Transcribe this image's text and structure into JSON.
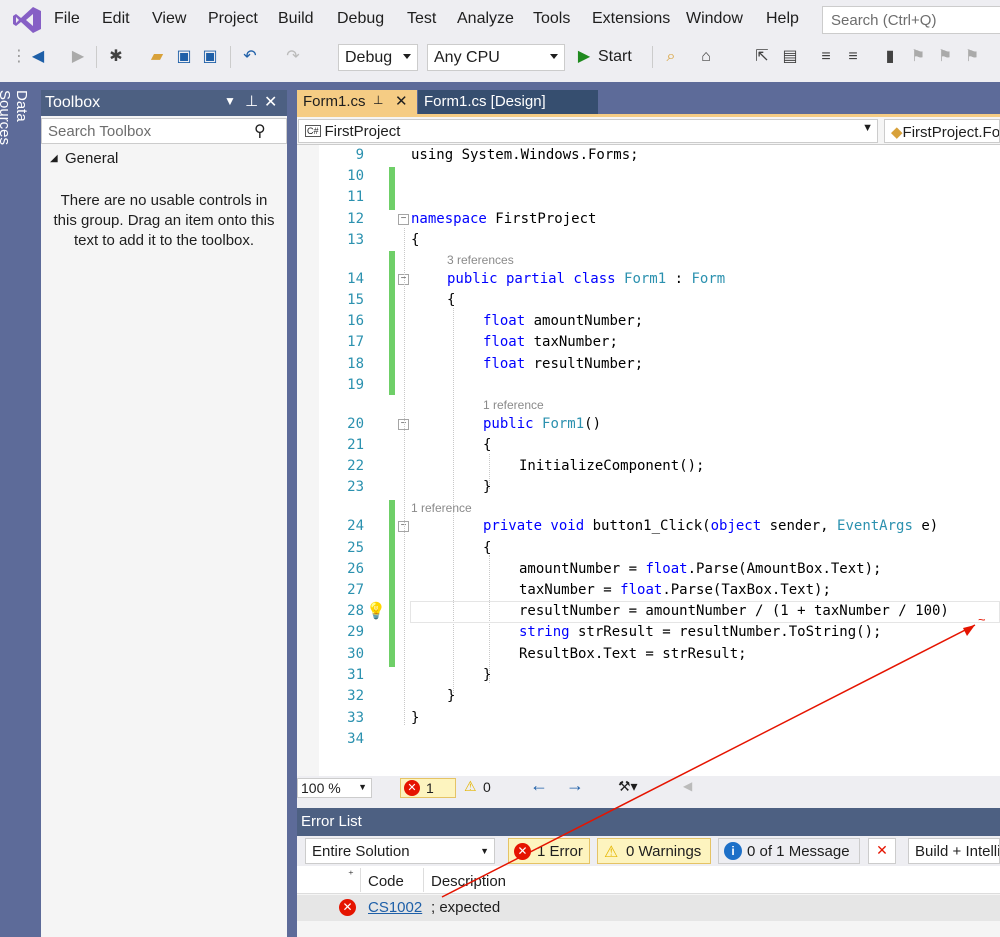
{
  "menu": {
    "items": [
      "File",
      "Edit",
      "View",
      "Project",
      "Build",
      "Debug",
      "Test",
      "Analyze",
      "Tools",
      "Extensions",
      "Window",
      "Help"
    ],
    "search_placeholder": "Search (Ctrl+Q)"
  },
  "toolbar": {
    "config": "Debug",
    "platform": "Any CPU",
    "start_label": "Start"
  },
  "side_tab": {
    "label": "Data Sources"
  },
  "toolbox": {
    "title": "Toolbox",
    "search_placeholder": "Search Toolbox",
    "group": "General",
    "empty_message": "There are no usable controls in this group. Drag an item onto this text to add it to the toolbox."
  },
  "tabs": [
    {
      "label": "Form1.cs",
      "active": true
    },
    {
      "label": "Form1.cs [Design]",
      "active": false
    }
  ],
  "navbar": {
    "project": "FirstProject",
    "member": "FirstProject.Fo"
  },
  "editor": {
    "lines": [
      {
        "n": "9"
      },
      {
        "n": "10"
      },
      {
        "n": "11"
      },
      {
        "n": "12"
      },
      {
        "n": "13"
      },
      {
        "n": "14"
      },
      {
        "n": "15"
      },
      {
        "n": "16"
      },
      {
        "n": "17"
      },
      {
        "n": "18"
      },
      {
        "n": "19"
      },
      {
        "n": "20"
      },
      {
        "n": "21"
      },
      {
        "n": "22"
      },
      {
        "n": "23"
      },
      {
        "n": "24"
      },
      {
        "n": "25"
      },
      {
        "n": "26"
      },
      {
        "n": "27"
      },
      {
        "n": "28"
      },
      {
        "n": "29"
      },
      {
        "n": "30"
      },
      {
        "n": "31"
      },
      {
        "n": "32"
      },
      {
        "n": "33"
      },
      {
        "n": "34"
      }
    ],
    "hints": {
      "class_refs": "3 references",
      "ctor_refs": "1 reference",
      "method_refs": "1 reference"
    },
    "code": {
      "l9": "using System.Windows.Forms;",
      "l12_kw": "namespace",
      "l12_rest": " FirstProject",
      "l13": "{",
      "l14_kw": "public partial class",
      "l14_ty": "Form1",
      "l14_colon": " : ",
      "l14_base": "Form",
      "l15": "{",
      "l16_kw": "float",
      "l16_rest": " amountNumber;",
      "l17_kw": "float",
      "l17_rest": " taxNumber;",
      "l18_kw": "float",
      "l18_rest": " resultNumber;",
      "l20_kw": "public",
      "l20_ty": "Form1",
      "l20_rest": "()",
      "l21": "{",
      "l22": "InitializeComponent();",
      "l23": "}",
      "l24_kw": "private void",
      "l24_name": " button1_Click(",
      "l24_kw2": "object",
      "l24_mid": " sender, ",
      "l24_ty": "EventArgs",
      "l24_end": " e)",
      "l25": "{",
      "l26_a": "amountNumber = ",
      "l26_kw": "float",
      "l26_b": ".Parse(AmountBox.Text);",
      "l27_a": "taxNumber = ",
      "l27_kw": "float",
      "l27_b": ".Parse(TaxBox.Text);",
      "l28": "resultNumber = amountNumber / (1 + taxNumber / 100)",
      "l29_kw": "string",
      "l29_rest": " strResult = resultNumber.ToString();",
      "l30": "ResultBox.Text = strResult;",
      "l31": "}",
      "l32": "}",
      "l33": "}"
    }
  },
  "editor_status": {
    "zoom": "100 %",
    "errors": "1",
    "warnings": "0"
  },
  "error_list": {
    "title": "Error List",
    "scope": "Entire Solution",
    "errors_btn": "1 Error",
    "warnings_btn": "0 Warnings",
    "messages_btn": "0 of 1 Message",
    "build_filter": "Build + Intelli",
    "columns": {
      "code": "Code",
      "description": "Description"
    },
    "rows": [
      {
        "code": "CS1002",
        "description": "; expected"
      }
    ]
  },
  "colors": {
    "accent": "#5d6b99",
    "active_tab": "#f5cc84",
    "error": "#e51400",
    "keyword": "#0000ff",
    "type": "#2b91af"
  }
}
